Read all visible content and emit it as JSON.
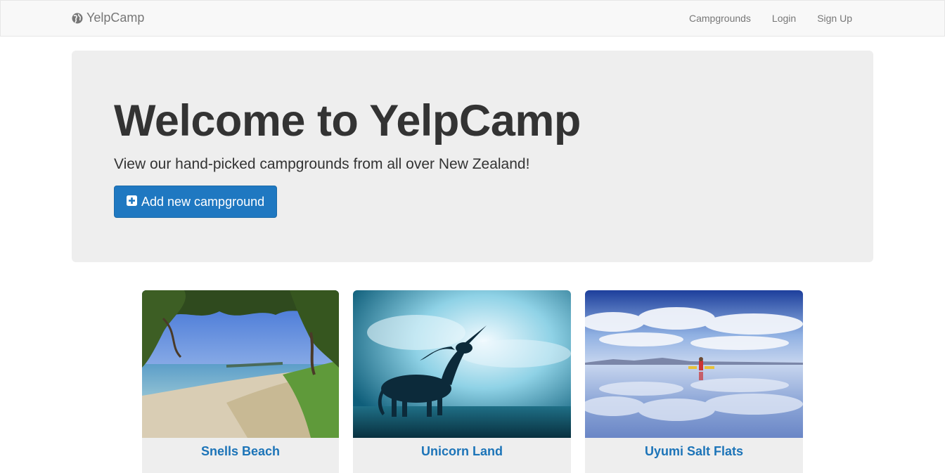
{
  "navbar": {
    "brand_icon": "globe-icon",
    "brand": "YelpCamp",
    "links": [
      {
        "label": "Campgrounds"
      },
      {
        "label": "Login"
      },
      {
        "label": "Sign Up"
      }
    ]
  },
  "jumbotron": {
    "title": "Welcome to YelpCamp",
    "subtitle": "View our hand-picked campgrounds from all over New Zealand!",
    "button_icon": "plus-square-icon",
    "button_label": "Add new campground"
  },
  "campgrounds": [
    {
      "name": "Snells Beach",
      "image": "beach with trees and shoreline"
    },
    {
      "name": "Unicorn Land",
      "image": "unicorn silhouette under blue sky"
    },
    {
      "name": "Uyumi Salt Flats",
      "image": "mirror salt flat with clouds and people"
    }
  ],
  "colors": {
    "navbar_bg": "#f8f8f8",
    "jumbotron_bg": "#eeeeee",
    "primary_button": "#1f78c1",
    "link_blue": "#1c74b8"
  }
}
